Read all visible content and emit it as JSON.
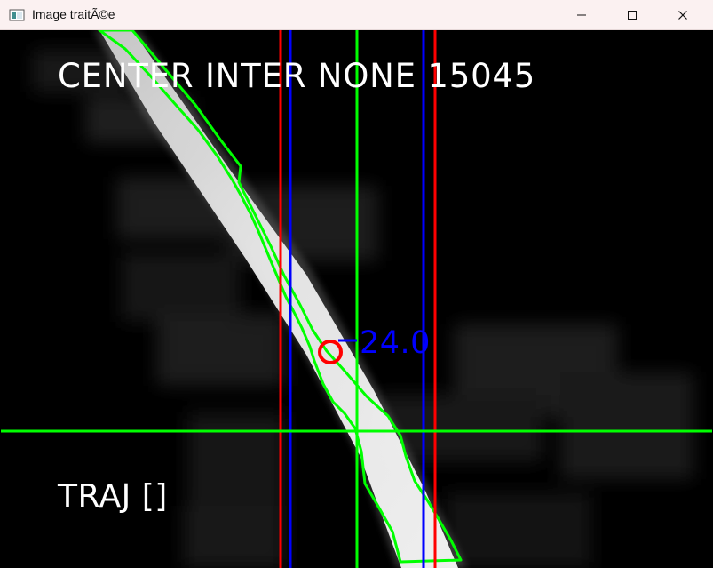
{
  "window": {
    "title": "Image traitÃ©e",
    "controls": {
      "minimize": "minimize",
      "maximize": "maximize",
      "close": "close"
    }
  },
  "overlay": {
    "status_text": "CENTER INTER NONE 15045",
    "offset_text": "24.0",
    "trajectory_text": "TRAJ []"
  },
  "icons": {
    "app": "window-image-icon",
    "minimize": "minimize-icon",
    "maximize": "maximize-icon",
    "close": "close-icon"
  },
  "colors": {
    "background": "#000000",
    "titlebar": "#fbf1f1",
    "white_text": "#ffffff",
    "green_lines": "#00ff00",
    "red_lines": "#ff0000",
    "blue_lines": "#0000ff",
    "target_circle": "#ff0000"
  }
}
